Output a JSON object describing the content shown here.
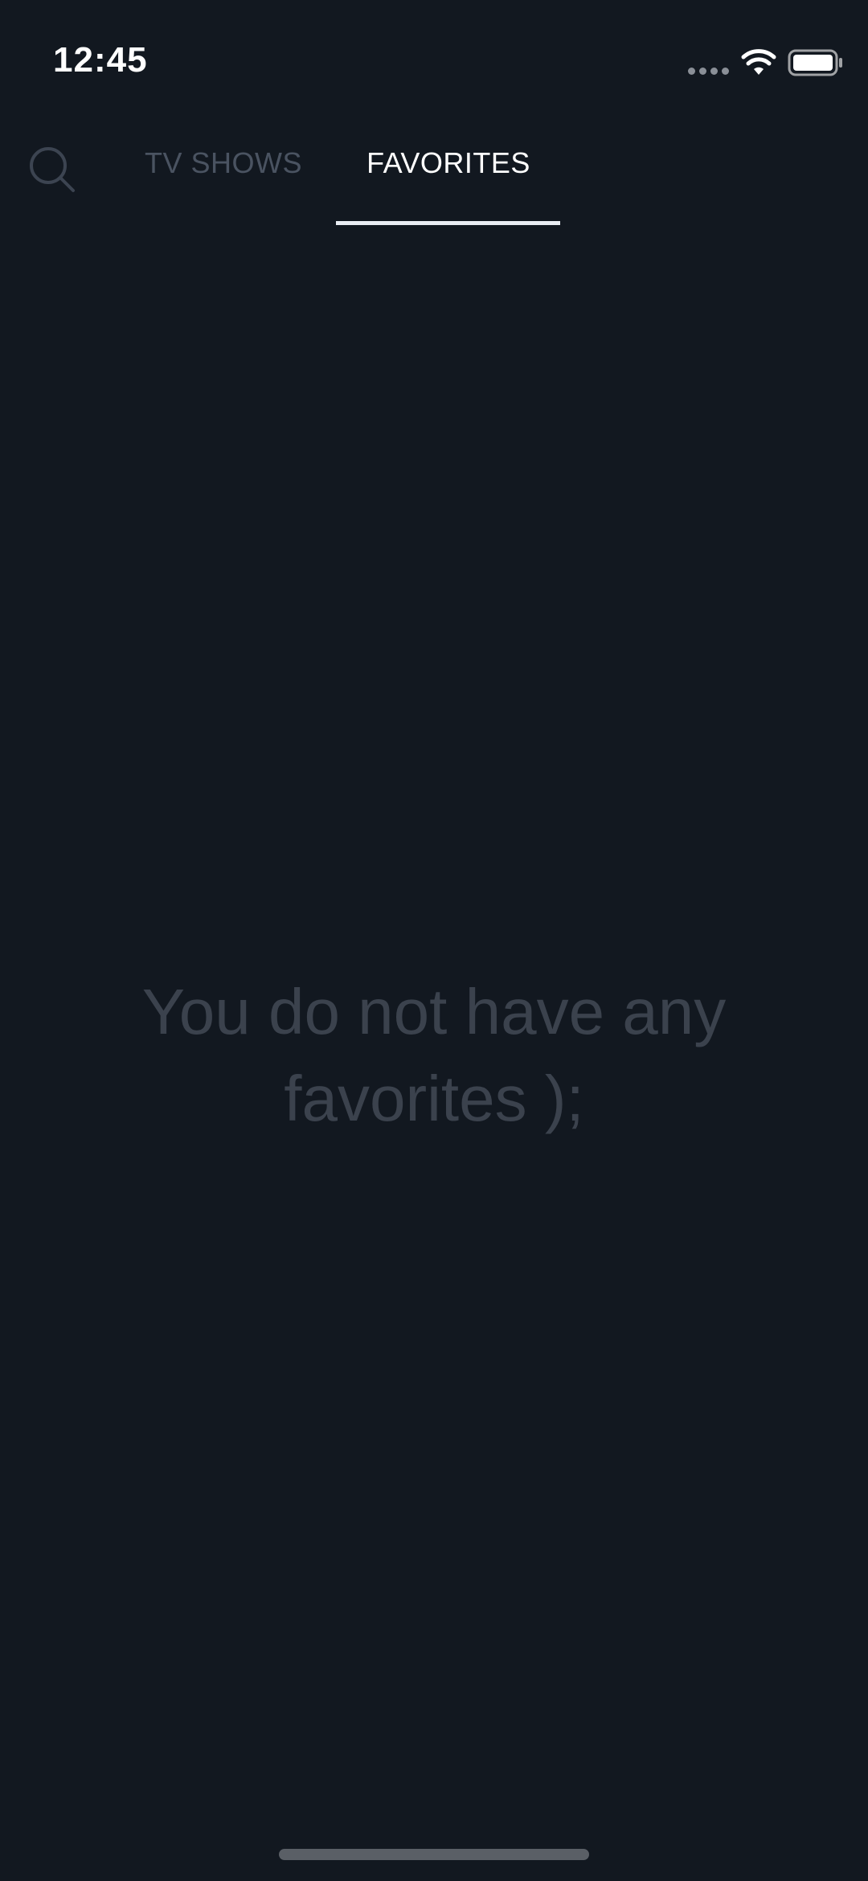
{
  "status_bar": {
    "time": "12:45",
    "icons": [
      "cellular-signal-icon",
      "wifi-icon",
      "battery-icon"
    ]
  },
  "tabs": {
    "search_icon": "search-icon",
    "items": [
      {
        "label": "TV SHOWS",
        "active": false
      },
      {
        "label": "FAVORITES",
        "active": true
      }
    ]
  },
  "empty_state": {
    "message": "You do not have any favorites );"
  },
  "colors": {
    "background": "#121820",
    "active_tab": "#ffffff",
    "inactive_tab": "#4a5361",
    "empty_text": "#3b424d"
  }
}
